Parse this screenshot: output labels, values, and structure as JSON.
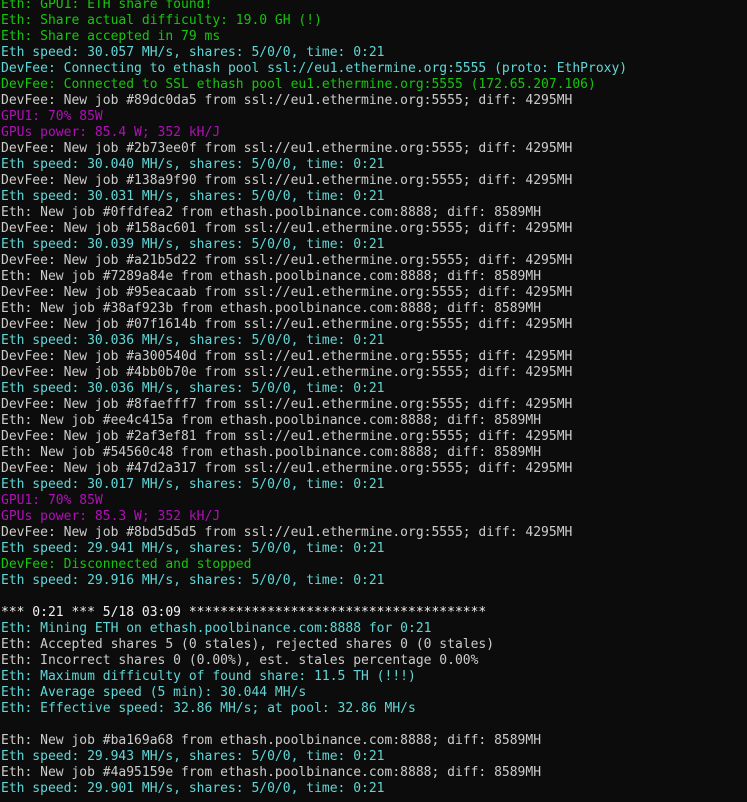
{
  "theme": {
    "background": "#0c0c0c",
    "colors": {
      "green": "#16c60c",
      "cyan": "#3a96dd",
      "teal": "#61d6d6",
      "purple": "#b10fb8",
      "white": "#cccccc",
      "bright": "#f2f2f2"
    }
  },
  "terminal": {
    "lines": [
      {
        "text": "Eth: GPU1: ETH share found!",
        "color": "green"
      },
      {
        "text": "Eth: Share actual difficulty: 19.0 GH (!)",
        "color": "green"
      },
      {
        "text": "Eth: Share accepted in 79 ms",
        "color": "green"
      },
      {
        "text": "Eth speed: 30.057 MH/s, shares: 5/0/0, time: 0:21",
        "color": "teal"
      },
      {
        "text": "DevFee: Connecting to ethash pool ssl://eu1.ethermine.org:5555 (proto: EthProxy)",
        "color": "teal"
      },
      {
        "text": "DevFee: Connected to SSL ethash pool eu1.ethermine.org:5555 (172.65.207.106)",
        "color": "green"
      },
      {
        "text": "DevFee: New job #89dc0da5 from ssl://eu1.ethermine.org:5555; diff: 4295MH",
        "color": "white"
      },
      {
        "text": "GPU1: 70% 85W",
        "color": "purple"
      },
      {
        "text": "GPUs power: 85.4 W; 352 kH/J",
        "color": "purple"
      },
      {
        "text": "DevFee: New job #2b73ee0f from ssl://eu1.ethermine.org:5555; diff: 4295MH",
        "color": "white"
      },
      {
        "text": "Eth speed: 30.040 MH/s, shares: 5/0/0, time: 0:21",
        "color": "teal"
      },
      {
        "text": "DevFee: New job #138a9f90 from ssl://eu1.ethermine.org:5555; diff: 4295MH",
        "color": "white"
      },
      {
        "text": "Eth speed: 30.031 MH/s, shares: 5/0/0, time: 0:21",
        "color": "teal"
      },
      {
        "text": "Eth: New job #0ffdfea2 from ethash.poolbinance.com:8888; diff: 8589MH",
        "color": "white"
      },
      {
        "text": "DevFee: New job #158ac601 from ssl://eu1.ethermine.org:5555; diff: 4295MH",
        "color": "white"
      },
      {
        "text": "Eth speed: 30.039 MH/s, shares: 5/0/0, time: 0:21",
        "color": "teal"
      },
      {
        "text": "DevFee: New job #a21b5d22 from ssl://eu1.ethermine.org:5555; diff: 4295MH",
        "color": "white"
      },
      {
        "text": "Eth: New job #7289a84e from ethash.poolbinance.com:8888; diff: 8589MH",
        "color": "white"
      },
      {
        "text": "DevFee: New job #95eacaab from ssl://eu1.ethermine.org:5555; diff: 4295MH",
        "color": "white"
      },
      {
        "text": "Eth: New job #38af923b from ethash.poolbinance.com:8888; diff: 8589MH",
        "color": "white"
      },
      {
        "text": "DevFee: New job #07f1614b from ssl://eu1.ethermine.org:5555; diff: 4295MH",
        "color": "white"
      },
      {
        "text": "Eth speed: 30.036 MH/s, shares: 5/0/0, time: 0:21",
        "color": "teal"
      },
      {
        "text": "DevFee: New job #a300540d from ssl://eu1.ethermine.org:5555; diff: 4295MH",
        "color": "white"
      },
      {
        "text": "DevFee: New job #4bb0b70e from ssl://eu1.ethermine.org:5555; diff: 4295MH",
        "color": "white"
      },
      {
        "text": "Eth speed: 30.036 MH/s, shares: 5/0/0, time: 0:21",
        "color": "teal"
      },
      {
        "text": "DevFee: New job #8faefff7 from ssl://eu1.ethermine.org:5555; diff: 4295MH",
        "color": "white"
      },
      {
        "text": "Eth: New job #ee4c415a from ethash.poolbinance.com:8888; diff: 8589MH",
        "color": "white"
      },
      {
        "text": "DevFee: New job #2af3ef81 from ssl://eu1.ethermine.org:5555; diff: 4295MH",
        "color": "white"
      },
      {
        "text": "Eth: New job #54560c48 from ethash.poolbinance.com:8888; diff: 8589MH",
        "color": "white"
      },
      {
        "text": "DevFee: New job #47d2a317 from ssl://eu1.ethermine.org:5555; diff: 4295MH",
        "color": "white"
      },
      {
        "text": "Eth speed: 30.017 MH/s, shares: 5/0/0, time: 0:21",
        "color": "teal"
      },
      {
        "text": "GPU1: 70% 85W",
        "color": "purple"
      },
      {
        "text": "GPUs power: 85.3 W; 352 kH/J",
        "color": "purple"
      },
      {
        "text": "DevFee: New job #8bd5d5d5 from ssl://eu1.ethermine.org:5555; diff: 4295MH",
        "color": "white"
      },
      {
        "text": "Eth speed: 29.941 MH/s, shares: 5/0/0, time: 0:21",
        "color": "teal"
      },
      {
        "text": "DevFee: Disconnected and stopped",
        "color": "green"
      },
      {
        "text": "Eth speed: 29.916 MH/s, shares: 5/0/0, time: 0:21",
        "color": "teal"
      },
      {
        "text": "",
        "color": "white"
      },
      {
        "text": "*** 0:21 *** 5/18 03:09 **************************************",
        "color": "bright"
      },
      {
        "text": "Eth: Mining ETH on ethash.poolbinance.com:8888 for 0:21",
        "color": "teal"
      },
      {
        "text": "Eth: Accepted shares 5 (0 stales), rejected shares 0 (0 stales)",
        "color": "white"
      },
      {
        "text": "Eth: Incorrect shares 0 (0.00%), est. stales percentage 0.00%",
        "color": "white"
      },
      {
        "text": "Eth: Maximum difficulty of found share: 11.5 TH (!!!)",
        "color": "teal"
      },
      {
        "text": "Eth: Average speed (5 min): 30.044 MH/s",
        "color": "teal"
      },
      {
        "text": "Eth: Effective speed: 32.86 MH/s; at pool: 32.86 MH/s",
        "color": "teal"
      },
      {
        "text": "",
        "color": "white"
      },
      {
        "text": "Eth: New job #ba169a68 from ethash.poolbinance.com:8888; diff: 8589MH",
        "color": "white"
      },
      {
        "text": "Eth speed: 29.943 MH/s, shares: 5/0/0, time: 0:21",
        "color": "teal"
      },
      {
        "text": "Eth: New job #4a95159e from ethash.poolbinance.com:8888; diff: 8589MH",
        "color": "white"
      },
      {
        "text": "Eth speed: 29.901 MH/s, shares: 5/0/0, time: 0:21",
        "color": "teal"
      }
    ]
  }
}
